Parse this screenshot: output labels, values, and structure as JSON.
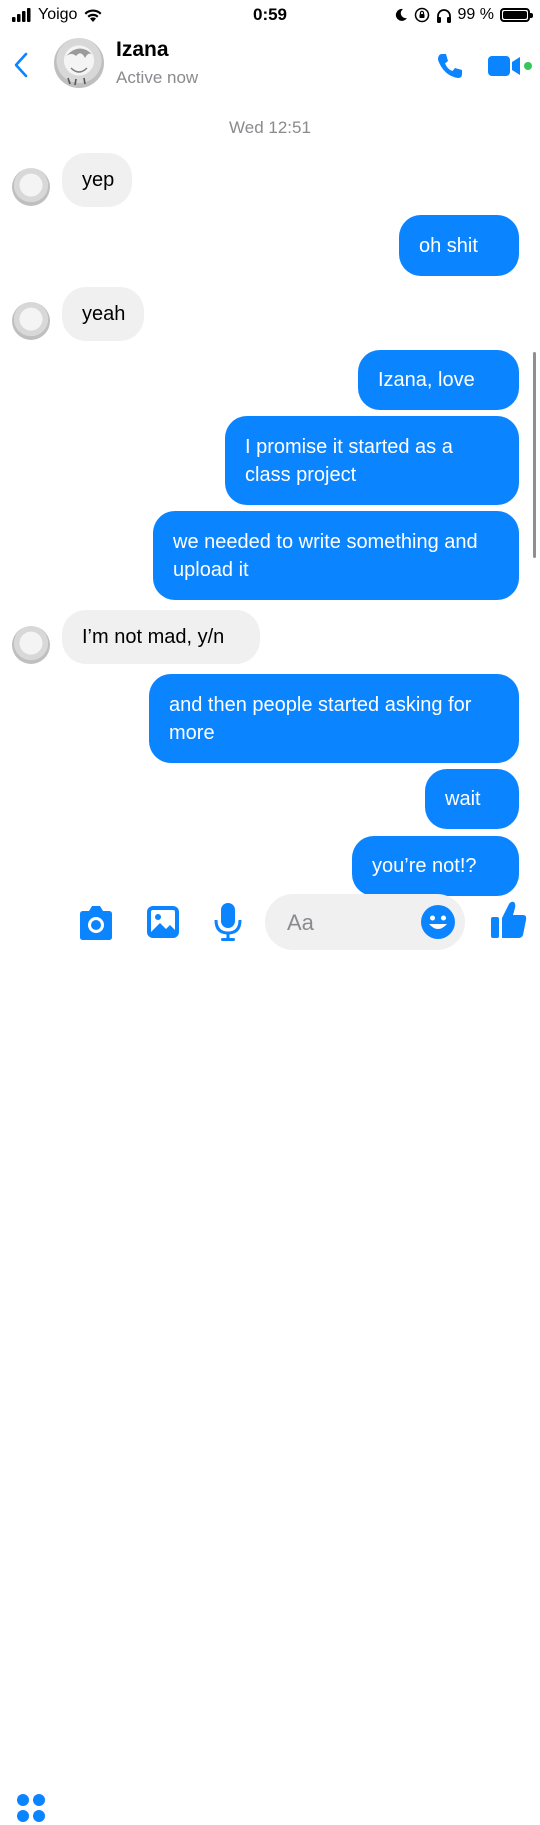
{
  "status_bar": {
    "carrier": "Yoigo",
    "time": "0:59",
    "battery": "99 %",
    "battery_level": 0.99
  },
  "header": {
    "name": "Izana",
    "status": "Active now"
  },
  "chat": {
    "timestamp": "Wed 12:51",
    "messages": [
      {
        "from": "them",
        "text": "yep"
      },
      {
        "from": "me",
        "text": "oh shit"
      },
      {
        "from": "them",
        "text": "yeah"
      },
      {
        "from": "me",
        "text": "Izana, love"
      },
      {
        "from": "me",
        "text": "I promise it started as a class project"
      },
      {
        "from": "me",
        "text": "we needed to write something and upload it"
      },
      {
        "from": "them",
        "text": "I’m not mad, y/n"
      },
      {
        "from": "me",
        "text": "and then people started asking for more"
      },
      {
        "from": "me",
        "text": "wait"
      },
      {
        "from": "me",
        "text": "you’re not!?"
      }
    ]
  },
  "composer": {
    "placeholder": "Aa"
  },
  "colors": {
    "accent": "#0a84ff",
    "incoming_bubble": "#f0f0f0",
    "online": "#34c759"
  }
}
